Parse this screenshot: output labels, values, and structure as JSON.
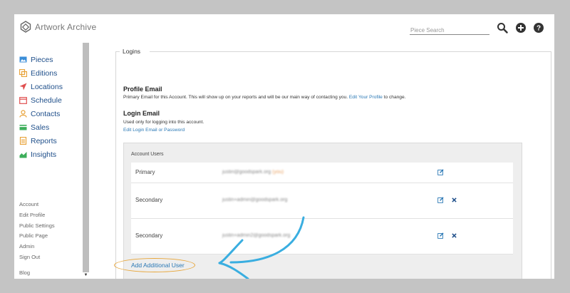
{
  "app": {
    "name": "Artwork Archive"
  },
  "header": {
    "search_placeholder": "Piece Search"
  },
  "nav": [
    {
      "label": "Pieces",
      "icon": "image-icon",
      "color": "#3b8ed8"
    },
    {
      "label": "Editions",
      "icon": "editions-icon",
      "color": "#e8a33a"
    },
    {
      "label": "Locations",
      "icon": "location-arrow-icon",
      "color": "#e05050"
    },
    {
      "label": "Schedule",
      "icon": "calendar-icon",
      "color": "#e05050"
    },
    {
      "label": "Contacts",
      "icon": "person-icon",
      "color": "#e8a33a"
    },
    {
      "label": "Sales",
      "icon": "credit-card-icon",
      "color": "#3cae5a"
    },
    {
      "label": "Reports",
      "icon": "document-icon",
      "color": "#e8a33a"
    },
    {
      "label": "Insights",
      "icon": "chart-icon",
      "color": "#3cae5a"
    }
  ],
  "account_links": [
    "Account",
    "Edit Profile",
    "Public Settings",
    "Public Page",
    "Admin",
    "Sign Out",
    "Blog"
  ],
  "logins": {
    "legend": "Logins",
    "profile_email": {
      "title": "Profile Email",
      "text": "Primary Email for this Account. This will show up on your reports and will be our main way of contacting you.",
      "link": "Edit Your Profile",
      "suffix": "to change."
    },
    "login_email": {
      "title": "Login Email",
      "text": "Used only for logging into this account.",
      "link": "Edit Login Email or Password"
    },
    "account_users": {
      "label": "Account Users",
      "rows": [
        {
          "role": "Primary",
          "email": "justin@goodspark.org",
          "tag": "(you)"
        },
        {
          "role": "Secondary",
          "email": "justin+admin@goodspark.org",
          "tag": ""
        },
        {
          "role": "Secondary",
          "email": "justin+admin2@goodspark.org",
          "tag": ""
        }
      ]
    },
    "add_user_label": "Add Additional User"
  },
  "colors": {
    "link": "#2a78b5",
    "annotation_arrow": "#3aaee0",
    "annotation_oval": "#e8a63a"
  }
}
